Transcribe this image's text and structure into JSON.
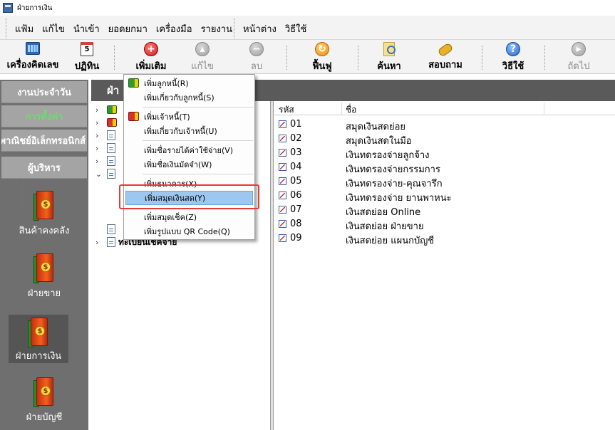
{
  "window": {
    "title": "ฝ่ายการเงิน"
  },
  "menubar": {
    "group1": [
      "แฟ้ม",
      "แก้ไข",
      "นำเข้า",
      "ยอดยกมา",
      "เครื่องมือ",
      "รายงาน"
    ],
    "group2": [
      "หน้าต่าง",
      "วิธีใช้"
    ]
  },
  "toolbar": {
    "calculator": "เครื่องคิดเลข",
    "calendar": "ปฏิทิน",
    "calendar_glyph": "5",
    "add": "เพิ่มเติม",
    "edit": "แก้ไข",
    "delete": "ลบ",
    "refresh": "ฟื้นฟู",
    "search": "ค้นหา",
    "inquiry": "สอบถาม",
    "help": "วิธีใช้",
    "next": "ถัดไป"
  },
  "sidebar": {
    "buttons": [
      "งานประจำวัน",
      "การตั้งค่า",
      "พาณิชย์อิเล็กทรอนิกส์",
      "ผู้บริหาร"
    ],
    "active_index": 1,
    "active_color": "#6cdc6c",
    "launchers": [
      "สินค้าคงคลัง",
      "ฝ่ายขาย",
      "ฝ่ายการเงิน",
      "ฝ่ายบัญชี"
    ],
    "selected_launcher": 2,
    "coin_glyph": "$"
  },
  "content": {
    "header": "ฝ่า",
    "tree_last_label": "ทะเบียนเช็คจ่าย",
    "list": {
      "columns": [
        "รหัส",
        "ชื่อ"
      ],
      "rows": [
        {
          "code": "01",
          "name": "สมุดเงินสดย่อย"
        },
        {
          "code": "02",
          "name": "สมุดเงินสดในมือ"
        },
        {
          "code": "03",
          "name": "เงินทดรองจ่ายลูกจ้าง"
        },
        {
          "code": "04",
          "name": "เงินทดรองจ่ายกรรมการ"
        },
        {
          "code": "05",
          "name": "เงินทดรองจ่าย-คุณจารึก"
        },
        {
          "code": "06",
          "name": "เงินทดรองจ่าย ยานพาหนะ"
        },
        {
          "code": "07",
          "name": "เงินสดย่อย Online"
        },
        {
          "code": "08",
          "name": "เงินสดย่อย ฝ่ายขาย"
        },
        {
          "code": "09",
          "name": "เงินสดย่อย แผนกบัญชี"
        }
      ]
    }
  },
  "dropdown": {
    "items": [
      "เพิ่มลูกหนี้(R)",
      "เพิ่มเกี่ยวกับลูกหนี้(S)",
      "เพิ่มเจ้าหนี้(T)",
      "เพิ่มเกี่ยวกับเจ้าหนี้(U)",
      "เพิ่มชื่อรายได้ค่าใช้จ่าย(V)",
      "เพิ่มชื่อเงินมัดจำ(W)",
      "เพิ่มธนาคาร(X)",
      "เพิ่มสมุดเงินสด(Y)",
      "เพิ่มสมุดเช็ค(Z)",
      "เพิ่มรูปแบบ QR Code(Q)"
    ],
    "highlighted_index": 7,
    "highlight_outline_color": "#e23b3b"
  }
}
